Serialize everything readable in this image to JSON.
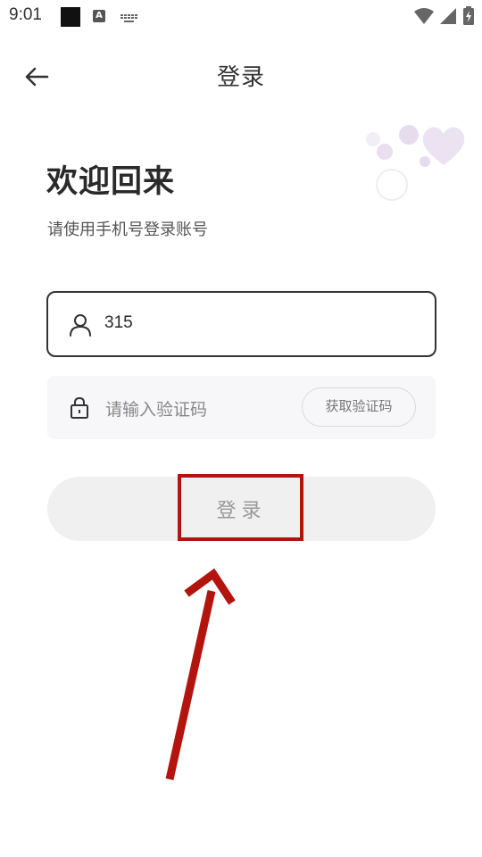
{
  "status_bar": {
    "time": "9:01",
    "notification_icon_label": "A"
  },
  "header": {
    "title": "登录"
  },
  "welcome": {
    "title": "欢迎回来",
    "subtitle": "请使用手机号登录账号"
  },
  "form": {
    "phone_value": "315",
    "code_placeholder": "请输入验证码",
    "get_code_label": "获取验证码",
    "login_label": "登录"
  },
  "annotation": {
    "color": "#b3140e"
  },
  "colors": {
    "text_primary": "#2a2a2a",
    "button_disabled_bg": "#f0f0f0",
    "decoration_purple": "#e6dcee"
  },
  "icons": {
    "back": "back-arrow-icon",
    "user": "user-icon",
    "lock": "lock-icon",
    "wifi": "wifi-icon",
    "signal": "signal-icon",
    "battery": "battery-icon"
  }
}
